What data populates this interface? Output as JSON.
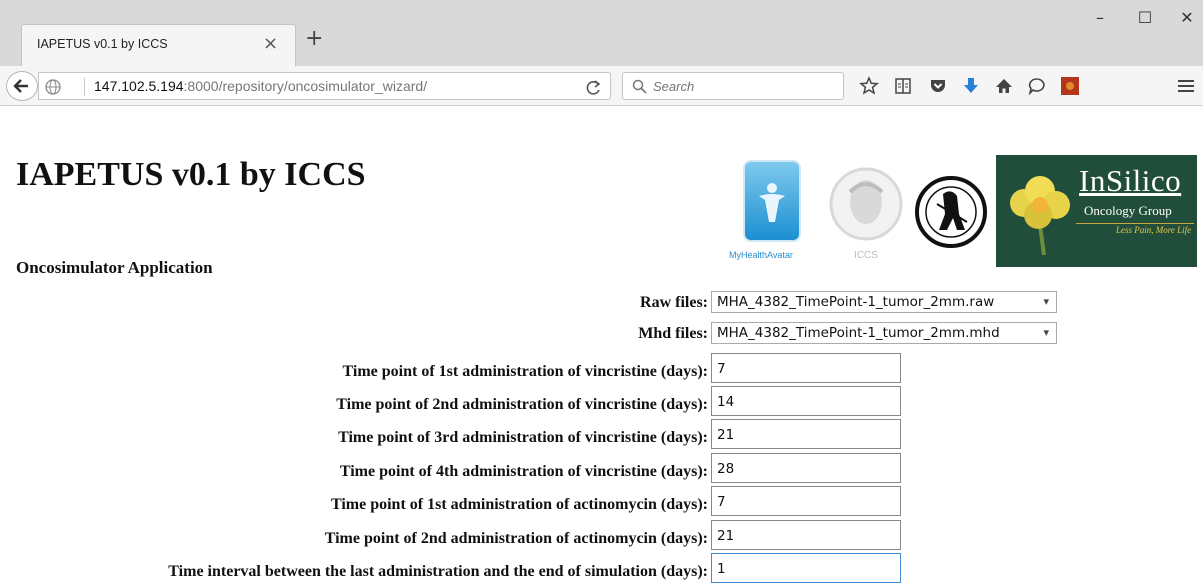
{
  "browser": {
    "tab_title": "IAPETUS v0.1 by ICCS",
    "tab_close": "×",
    "new_tab": "+",
    "url_host": "147.102.5.194",
    "url_rest": ":8000/repository/oncosimulator_wizard/",
    "search_placeholder": "Search",
    "window_controls": {
      "minimize": "–",
      "maximize": "☐",
      "close": "✕"
    }
  },
  "page": {
    "title": "IAPETUS v0.1 by ICCS",
    "subtitle": "Oncosimulator Application"
  },
  "logos": {
    "mha_text": "MyHealthAvatar",
    "iccs_text": "ICCS",
    "insilico_title": "InSilico",
    "insilico_subtitle": "Oncology Group",
    "insilico_tagline": "Less Pain, More Life"
  },
  "form": {
    "raw_files": {
      "label": "Raw files:",
      "value": "MHA_4382_TimePoint-1_tumor_2mm.raw"
    },
    "mhd_files": {
      "label": "Mhd files:",
      "value": "MHA_4382_TimePoint-1_tumor_2mm.mhd"
    },
    "fields": [
      {
        "label": "Time point of 1st administration of vincristine (days):",
        "value": "7"
      },
      {
        "label": "Time point of 2nd administration of vincristine (days):",
        "value": "14"
      },
      {
        "label": "Time point of 3rd administration of vincristine (days):",
        "value": "21"
      },
      {
        "label": "Time point of 4th administration of vincristine (days):",
        "value": "28"
      },
      {
        "label": "Time point of 1st administration of actinomycin (days):",
        "value": "7"
      },
      {
        "label": "Time point of 2nd administration of actinomycin (days):",
        "value": "21"
      },
      {
        "label": "Time interval between the last administration and the end of simulation (days):",
        "value": "1"
      }
    ]
  },
  "colors": {
    "tabstrip_bg": "#d9d9d9",
    "toolbar_bg": "#f5f5f5",
    "download_arrow": "#2a7fd6",
    "insilico_bg": "#214d3b",
    "focus_border": "#3f8ed6"
  }
}
